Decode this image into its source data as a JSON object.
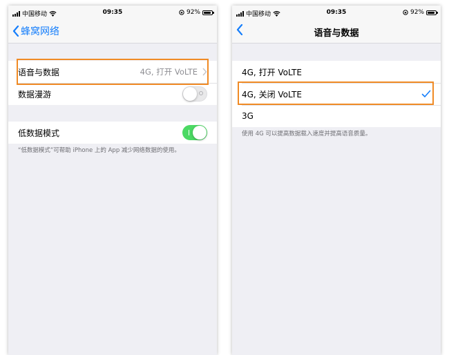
{
  "status_bar": {
    "carrier": "中国移动",
    "time": "09:35",
    "battery": "92%"
  },
  "left_screen": {
    "back_label": "蜂窝网络",
    "voice_data_label": "语音与数据",
    "voice_data_value": "4G, 打开 VoLTE",
    "roaming_label": "数据漫游",
    "roaming_enabled": false,
    "low_data_label": "低数据模式",
    "low_data_enabled": true,
    "low_data_footnote": "“低数据模式”可帮助 iPhone 上的 App 减少网络数据的使用。"
  },
  "right_screen": {
    "title": "语音与数据",
    "options": [
      {
        "label": "4G, 打开 VoLTE",
        "selected": false
      },
      {
        "label": "4G, 关闭 VoLTE",
        "selected": true
      },
      {
        "label": "3G",
        "selected": false
      }
    ],
    "footnote": "使用 4G 可以提高数据载入速度并提高语音质量。"
  },
  "colors": {
    "accent": "#157efb",
    "toggle_on": "#4cd964",
    "highlight": "#f08a24",
    "background": "#efeff4"
  }
}
